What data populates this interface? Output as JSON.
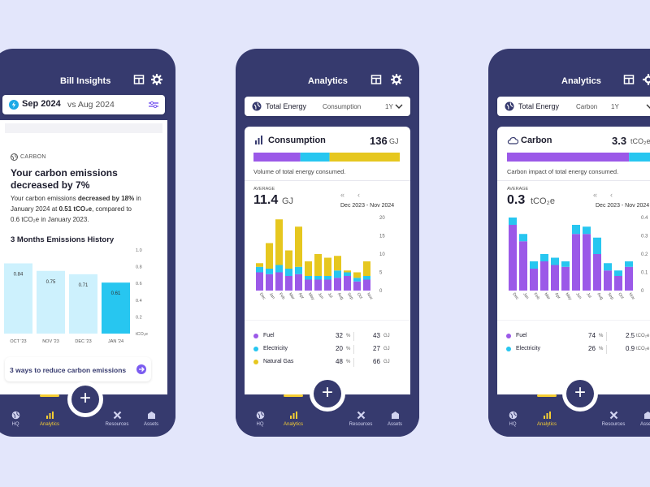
{
  "colors": {
    "background": "#e3e6fb",
    "navy": "#363a6e",
    "purple": "#9b59e8",
    "cyan": "#27c6f0",
    "yellow": "#e6c71f",
    "light_cyan": "#cdf1fd",
    "accent": "#f5cd33"
  },
  "icons": [
    "plus-icon",
    "settings-icon",
    "layout-icon",
    "filter-icon",
    "bolt-icon",
    "globe-icon",
    "chevron-down-icon",
    "bar-chart-icon",
    "cloud-icon",
    "arrow-right-icon",
    "double-chevron-left-icon",
    "chevron-left-icon"
  ],
  "tabs": [
    {
      "label": "HQ",
      "icon": "globe-icon"
    },
    {
      "label": "Analytics",
      "icon": "bar-chart-icon"
    },
    {
      "label": "Resources",
      "icon": "tools-icon"
    },
    {
      "label": "Assets",
      "icon": "building-icon"
    }
  ],
  "screen1": {
    "title": "Bill Insights",
    "period": "Sep 2024",
    "vs": "vs Aug 2024",
    "category": "CARBON",
    "headline_line1": "Your carbon emissions",
    "headline_line2": "decreased by 7%",
    "body_line1_a": "Your carbon emissions ",
    "body_line1_b": "decreased by 18%",
    "body_line1_c": " in",
    "body_line2_a": "January 2024 at ",
    "body_line2_b": "0.51 tCO₂e",
    "body_line2_c": ", compared to",
    "body_line3": "0.6 tCO₂e in January 2023.",
    "history_title": "3 Months Emissions History",
    "cta": "3 ways to reduce carbon emissions",
    "chart_data": {
      "type": "bar",
      "categories": [
        "OCT '23",
        "NOV '23",
        "DEC '23",
        "JAN '24"
      ],
      "values": [
        0.84,
        0.75,
        0.71,
        0.61
      ],
      "ylim": [
        0,
        1.0
      ],
      "yticks": [
        "1.0",
        "0.8",
        "0.6",
        "0.4",
        "0.2",
        "tCO₂e"
      ],
      "highlight": "JAN '24"
    }
  },
  "screen2": {
    "title": "Analytics",
    "selector_label": "Total Energy",
    "selector_metric": "Consumption",
    "selector_period": "1Y",
    "card_title": "Consumption",
    "card_value": "136",
    "card_unit": "GJ",
    "share_bar": {
      "purple": 32,
      "cyan": 20,
      "yellow": 48
    },
    "description": "Volume of total energy consumed.",
    "average_label": "AVERAGE",
    "average_value": "11.4",
    "average_unit": "GJ",
    "range": "Dec 2023 - Nov 2024",
    "legend": [
      {
        "name": "Fuel",
        "pct": "32",
        "unit_pct": "%",
        "value": "43",
        "unit": "GJ",
        "color": "#9b59e8"
      },
      {
        "name": "Electricity",
        "pct": "20",
        "unit_pct": "%",
        "value": "27",
        "unit": "GJ",
        "color": "#27c6f0"
      },
      {
        "name": "Natural Gas",
        "pct": "48",
        "unit_pct": "%",
        "value": "66",
        "unit": "GJ",
        "color": "#e6c71f"
      }
    ],
    "chart_data": {
      "type": "bar",
      "stacked": true,
      "categories": [
        "Dec",
        "Jan",
        "Feb",
        "Mar",
        "Apr",
        "May",
        "Jun",
        "Jul",
        "Aug",
        "Sep",
        "Oct",
        "Nov"
      ],
      "series": [
        {
          "name": "Fuel",
          "values": [
            5,
            4.5,
            5,
            4,
            4.5,
            3,
            3,
            3,
            3.5,
            4,
            2.5,
            3
          ]
        },
        {
          "name": "Electricity",
          "values": [
            1.5,
            1.5,
            2,
            2,
            2,
            1,
            1,
            1,
            2,
            1,
            1,
            1
          ]
        },
        {
          "name": "Natural Gas",
          "values": [
            1,
            7,
            12.5,
            5,
            11,
            4,
            6,
            5,
            4,
            0.5,
            1.5,
            4
          ]
        }
      ],
      "ylim": [
        0,
        20
      ],
      "yticks": [
        0,
        5,
        10,
        15,
        20
      ]
    }
  },
  "screen3": {
    "title": "Analytics",
    "selector_label": "Total Energy",
    "selector_metric": "Carbon",
    "selector_period": "1Y",
    "card_title": "Carbon",
    "card_value": "3.3",
    "card_unit": "tCO₂e",
    "share_bar": {
      "purple": 74,
      "cyan": 26
    },
    "description": "Carbon impact of total energy consumed.",
    "average_label": "AVERAGE",
    "average_value": "0.3",
    "average_unit": "tCO₂e",
    "range": "Dec 2023 - Nov 2024",
    "legend": [
      {
        "name": "Fuel",
        "pct": "74",
        "unit_pct": "%",
        "value": "2.5",
        "unit": "tCO₂e",
        "color": "#9b59e8"
      },
      {
        "name": "Electricity",
        "pct": "26",
        "unit_pct": "%",
        "value": "0.9",
        "unit": "tCO₂e",
        "color": "#27c6f0"
      }
    ],
    "chart_data": {
      "type": "bar",
      "stacked": true,
      "categories": [
        "Dec",
        "Jan",
        "Feb",
        "Mar",
        "Apr",
        "May",
        "Jun",
        "Jul",
        "Aug",
        "Sep",
        "Oct",
        "Nov"
      ],
      "series": [
        {
          "name": "Fuel",
          "values": [
            0.36,
            0.27,
            0.12,
            0.16,
            0.14,
            0.13,
            0.31,
            0.31,
            0.2,
            0.11,
            0.08,
            0.13
          ]
        },
        {
          "name": "Electricity",
          "values": [
            0.04,
            0.04,
            0.04,
            0.04,
            0.04,
            0.03,
            0.05,
            0.04,
            0.09,
            0.04,
            0.03,
            0.03
          ]
        }
      ],
      "ylim": [
        0,
        0.4
      ],
      "yticks": [
        "0.4",
        "0.3",
        "0.2",
        "0.1",
        "0"
      ]
    }
  }
}
